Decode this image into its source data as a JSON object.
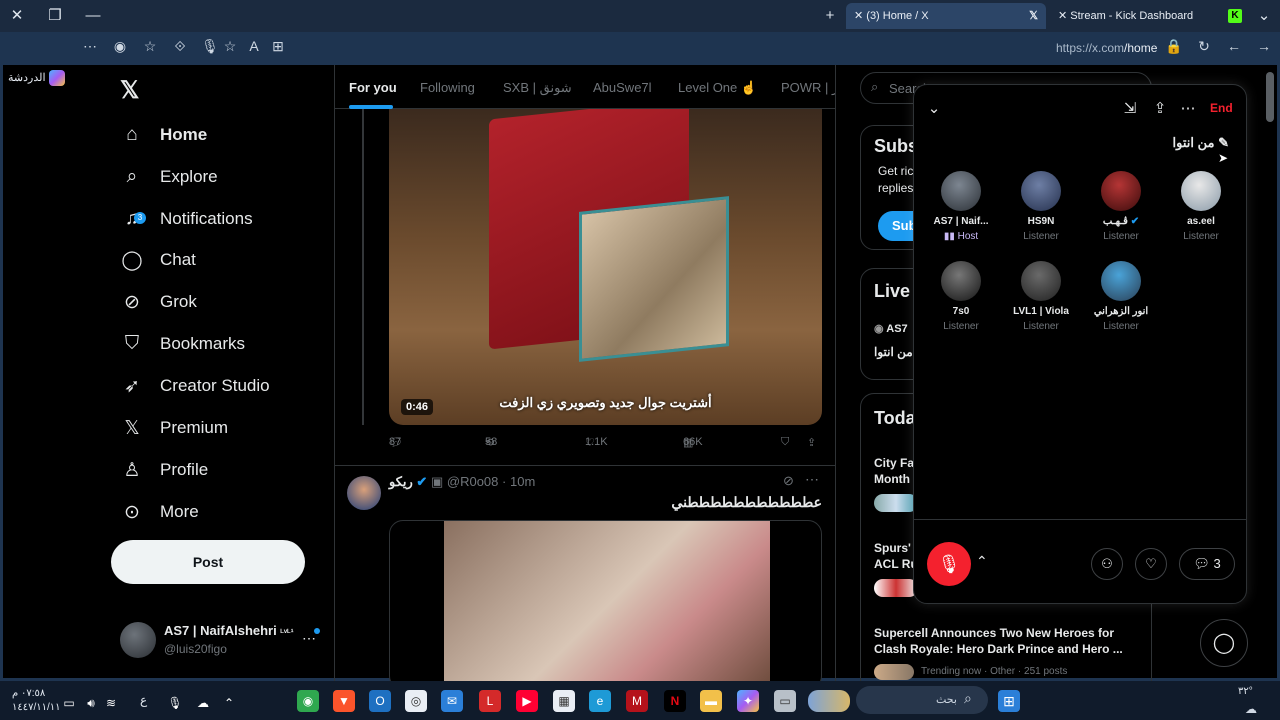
{
  "browser": {
    "tabs": [
      {
        "label": "(3) Home / X",
        "active": true
      },
      {
        "label": "Stream - Kick Dashboard",
        "active": false
      }
    ],
    "url_host": "https://x.com",
    "url_path": "/home",
    "chat_label": "الدردشة"
  },
  "nav": {
    "items": [
      {
        "label": "Home",
        "icon": "home-icon"
      },
      {
        "label": "Explore",
        "icon": "search-icon"
      },
      {
        "label": "Notifications",
        "icon": "bell-icon",
        "badge": "3"
      },
      {
        "label": "Chat",
        "icon": "chat-icon"
      },
      {
        "label": "Grok",
        "icon": "grok-icon"
      },
      {
        "label": "Bookmarks",
        "icon": "bookmark-icon"
      },
      {
        "label": "Creator Studio",
        "icon": "rocket-icon"
      },
      {
        "label": "Premium",
        "icon": "x-icon"
      },
      {
        "label": "Profile",
        "icon": "person-icon"
      },
      {
        "label": "More",
        "icon": "more-icon"
      }
    ],
    "post_label": "Post",
    "account": {
      "name": "AS7 | NaifAlshehri",
      "tag": "ᴸᵛᴸ¹",
      "handle": "@luis20figo"
    }
  },
  "feed": {
    "tabs": [
      "For you",
      "Following",
      "SXB | شونق",
      "AbuSwe7l",
      "Level One ☝️",
      "POWR | ير"
    ],
    "tweet1": {
      "duration": "0:46",
      "subtitle": "أشتريت جوال جديد وتصويري زي الزفت",
      "replies": "87",
      "reposts": "58",
      "likes": "1.1K",
      "views": "66K"
    },
    "tweet2": {
      "name": "ريكو",
      "handle": "@R0o08",
      "time": "10m",
      "text": "عطططططططططططني"
    }
  },
  "right": {
    "search_placeholder": "Search",
    "subscribe": {
      "title": "Subs",
      "line1": "Get ric",
      "line2": "replies",
      "button": "Sub"
    },
    "live": {
      "title": "Live o",
      "host": "AS7",
      "space": "من انتوا"
    },
    "trends": {
      "title": "Toda",
      "items": [
        {
          "title1": "City Fa",
          "title2": "Month"
        },
        {
          "title1": "Spurs'",
          "title2": "ACL Ru"
        },
        {
          "title1": "Supercell Announces Two New Heroes for",
          "title2": "Clash Royale: Hero Dark Prince and Hero ...",
          "meta": "Trending now · Other · 251 posts"
        }
      ]
    }
  },
  "space": {
    "end_label": "End",
    "title": "من انتوا",
    "participants": [
      {
        "name": "AS7 | Naif...",
        "role": "Host"
      },
      {
        "name": "HS9N",
        "role": "Listener"
      },
      {
        "name": "ڤـﻬـب",
        "role": "Listener"
      },
      {
        "name": "as.eel",
        "role": "Listener"
      },
      {
        "name": "7s0",
        "role": "Listener"
      },
      {
        "name": "LVL1 | Viola",
        "role": "Listener"
      },
      {
        "name": "انور الزهراني",
        "role": "Listener"
      }
    ],
    "comment_count": "3"
  },
  "taskbar": {
    "time": "٠٧:٥٨ م",
    "date": "١٤٤٧/١١/١١",
    "lang": "ع",
    "search_label": "بحث",
    "weather": "٣٢°"
  }
}
